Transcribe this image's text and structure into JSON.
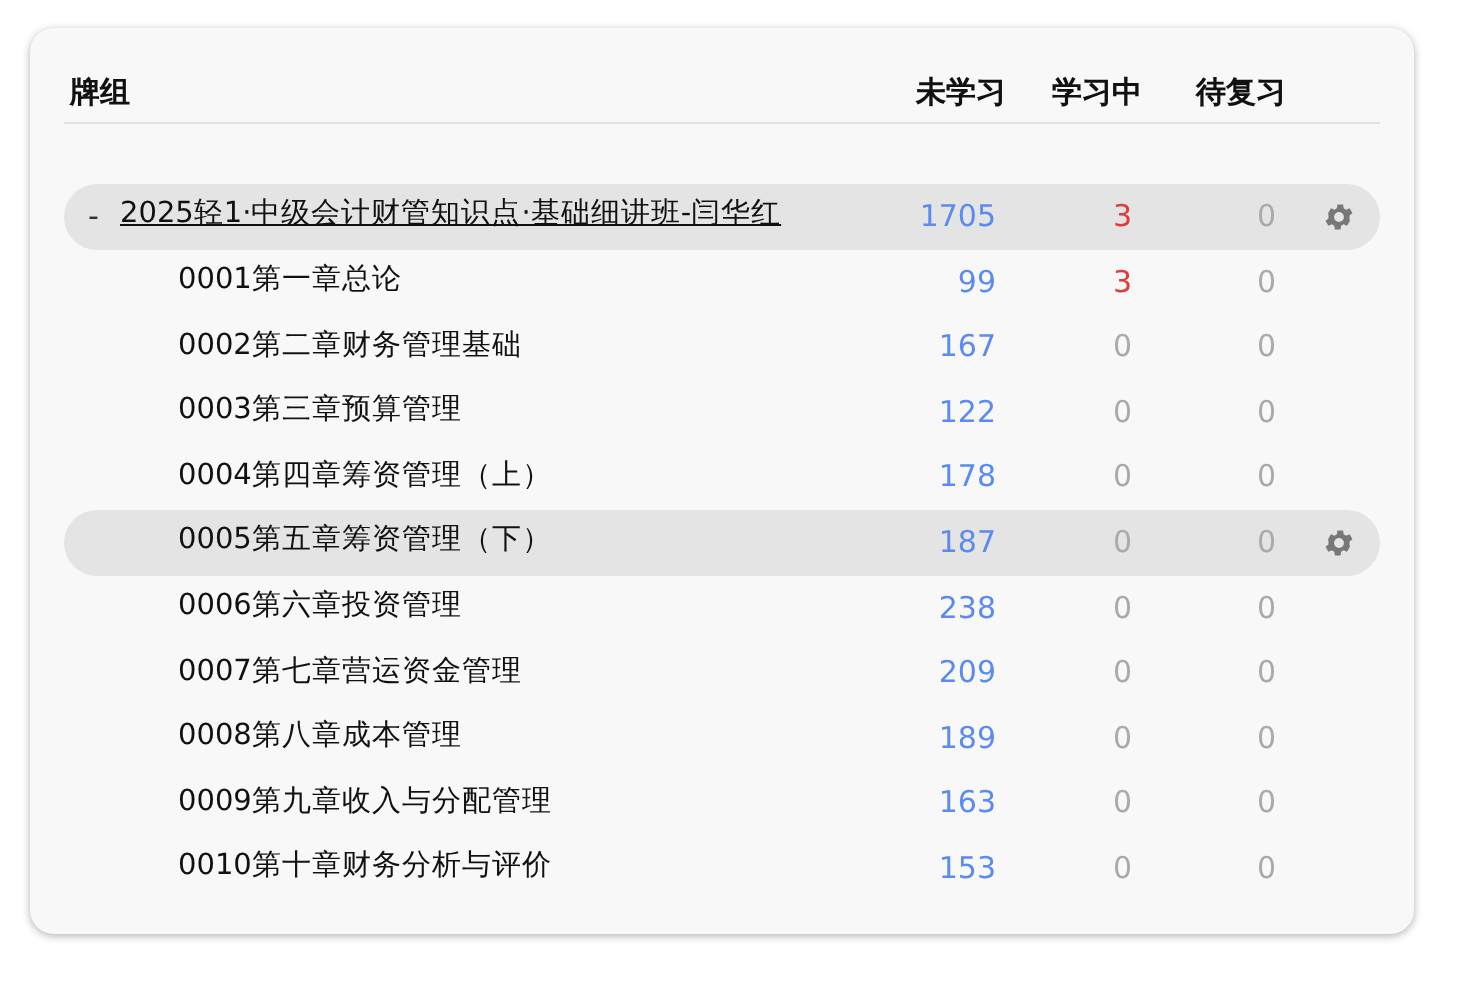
{
  "columns": {
    "deck": "牌组",
    "new": "未学习",
    "learn": "学习中",
    "due": "待复习"
  },
  "deck": {
    "toggle": "-",
    "name": "2025轻1·中级会计财管知识点·基础细讲班-闫华红",
    "new": "1705",
    "learn": "3",
    "due": "0",
    "selected": true,
    "expanded": true,
    "children": [
      {
        "name": "0001第一章总论",
        "new": "99",
        "learn": "3",
        "due": "0",
        "selected": false
      },
      {
        "name": "0002第二章财务管理基础",
        "new": "167",
        "learn": "0",
        "due": "0",
        "selected": false
      },
      {
        "name": "0003第三章预算管理",
        "new": "122",
        "learn": "0",
        "due": "0",
        "selected": false
      },
      {
        "name": "0004第四章筹资管理（上）",
        "new": "178",
        "learn": "0",
        "due": "0",
        "selected": false
      },
      {
        "name": "0005第五章筹资管理（下）",
        "new": "187",
        "learn": "0",
        "due": "0",
        "selected": true
      },
      {
        "name": "0006第六章投资管理",
        "new": "238",
        "learn": "0",
        "due": "0",
        "selected": false
      },
      {
        "name": "0007第七章营运资金管理",
        "new": "209",
        "learn": "0",
        "due": "0",
        "selected": false
      },
      {
        "name": "0008第八章成本管理",
        "new": "189",
        "learn": "0",
        "due": "0",
        "selected": false
      },
      {
        "name": "0009第九章收入与分配管理",
        "new": "163",
        "learn": "0",
        "due": "0",
        "selected": false
      },
      {
        "name": "0010第十章财务分析与评价",
        "new": "153",
        "learn": "0",
        "due": "0",
        "selected": false
      }
    ]
  }
}
